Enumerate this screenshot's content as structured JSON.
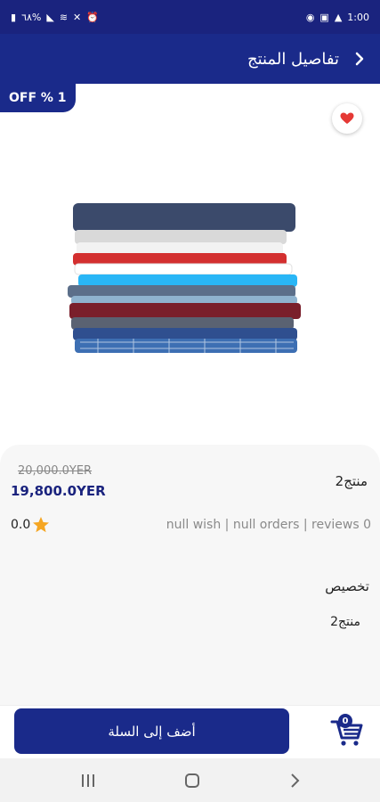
{
  "status_bar": {
    "left_text": "٦٨% ",
    "time": "1:00"
  },
  "header": {
    "title": "تفاصيل المنتج"
  },
  "discount_badge": "OFF % 1",
  "product": {
    "old_price": "20,000.0YER",
    "new_price": "19,800.0YER",
    "name": "منتج2",
    "rating": "0.0",
    "stats": "null wish | null orders | reviews 0",
    "section_title": "تخصيص",
    "description": "منتج2"
  },
  "actions": {
    "add_to_cart": "أضف إلى السلة",
    "cart_count": "0"
  },
  "colors": {
    "primary": "#1a2a8a",
    "star": "#f5a623",
    "heart": "#e53935"
  }
}
